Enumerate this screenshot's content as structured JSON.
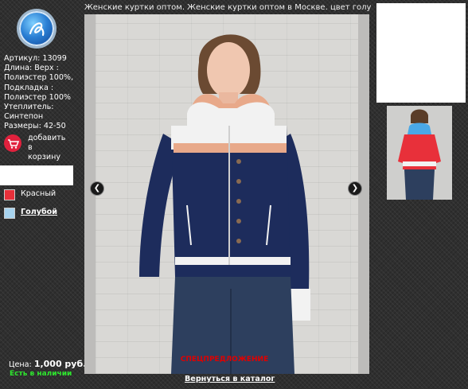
{
  "page": {
    "title": "Женские куртки оптом. Женские куртки оптом в Москве. цвет голубой"
  },
  "logo": {
    "icon": "brand-logo-icon"
  },
  "specs": [
    "Артикул: 13099",
    "Длина: Верх :",
    "Полиэстер 100%,",
    "Подкладка :",
    "Полиэстер 100%",
    "Утеплитель:",
    "Синтепон",
    "Размеры: 42-50"
  ],
  "cart": {
    "icon": "cart-icon",
    "label_lines": [
      "добавить",
      "в",
      "корзину"
    ]
  },
  "colors": [
    {
      "label": "Красный",
      "swatch": "#e8303a",
      "selected": false
    },
    {
      "label": "Голубой",
      "swatch": "#a8d4ef",
      "selected": true
    }
  ],
  "price": {
    "label": "Цена:",
    "value": "1,000 руб."
  },
  "stock": "Есть в наличии",
  "gallery": {
    "promo": "СПЕЦПРЕДЛОЖЕНИЕ",
    "back_link": "Вернуться в каталог",
    "prev_icon": "chevron-left-icon",
    "next_icon": "chevron-right-icon"
  },
  "colors_scheme": {
    "jacket_navy": "#1d2c5c",
    "jacket_white": "#f2f2f2",
    "jacket_peach": "#e8a98a",
    "thumb_red": "#e8303a"
  }
}
